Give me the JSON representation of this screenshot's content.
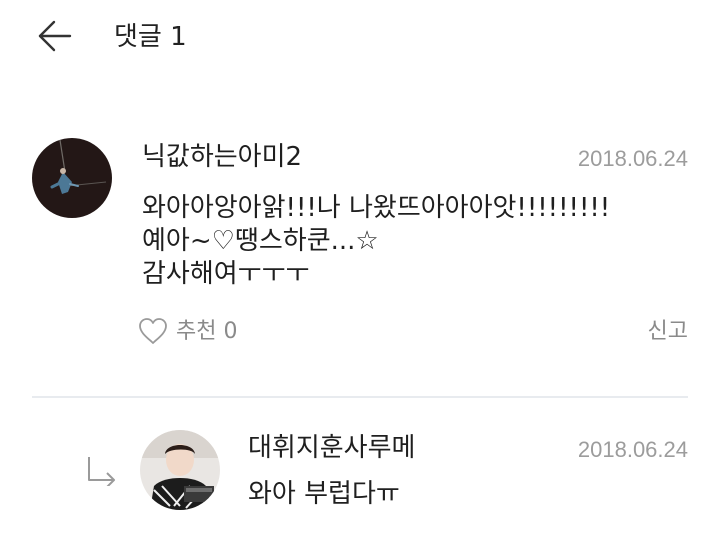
{
  "header": {
    "title": "댓글 1"
  },
  "icons": {
    "back": "back-arrow-icon",
    "like": "heart-outline-icon",
    "reply": "reply-arrow-icon"
  },
  "colors": {
    "text": "#1f1f1f",
    "muted": "#9c9c9c",
    "divider": "#e8ebef"
  },
  "comments": [
    {
      "username": "닉값하는아미2",
      "date": "2018.06.24",
      "lines": [
        "와아아앙아앍!!!나 나왔뜨아아아앗!!!!!!!!!",
        "예아~♡땡스하쿤...☆",
        "감사해여ㅜㅜㅜ"
      ],
      "like_label": "추천",
      "like_count": "0",
      "report_label": "신고"
    }
  ],
  "replies": [
    {
      "username": "대휘지훈사루메",
      "date": "2018.06.24",
      "text": "와아 부럽다ㅠ"
    }
  ]
}
